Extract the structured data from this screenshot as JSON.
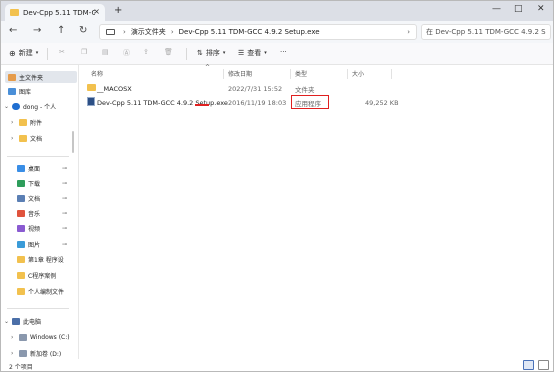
{
  "window": {
    "tab_title": "Dev-Cpp 5.11 TDM-GCC 4.9.2 S",
    "new_tab": "+",
    "minimize": "—",
    "maximize": "□",
    "close": "✕",
    "tab_close": "×"
  },
  "nav": {
    "back": "←",
    "forward": "→",
    "up": "↑",
    "refresh": "↻"
  },
  "address": {
    "crumbs": [
      "演示文件夹",
      "Dev-Cpp 5.11 TDM-GCC 4.9.2 Setup.exe"
    ],
    "search_placeholder": "在 Dev-Cpp 5.11 TDM-GCC 4.9.2 S"
  },
  "toolbar": {
    "new_label": "新建",
    "sort_label": "排序",
    "view_label": "查看",
    "more_label": "···"
  },
  "sidebar": {
    "home": "主文件夹",
    "gallery": "图库",
    "onedrive": "dong - 个人",
    "attachments": "附件",
    "documents_od": "文档",
    "desktop": "桌面",
    "downloads": "下载",
    "documents": "文档",
    "music": "音乐",
    "videos": "视频",
    "pictures": "图片",
    "chapter1": "第1章 程序设",
    "c_examples": "C程序案例",
    "personal": "个人编制文件",
    "this_pc": "此电脑",
    "windows_c": "Windows (C:)",
    "new_volume_d": "新加卷 (D:)",
    "pin_glyph": "⊸"
  },
  "columns": {
    "name": "名称",
    "modified": "修改日期",
    "type": "类型",
    "size": "大小",
    "sort_caret": "^"
  },
  "files": [
    {
      "name": "__MACOSX",
      "modified": "2022/7/31 15:52",
      "type": "文件夹",
      "size": ""
    },
    {
      "name": "Dev-Cpp 5.11 TDM-GCC 4.9.2 Setup.exe",
      "modified": "2016/11/19 18:03",
      "type": "应用程序",
      "size": "49,252 KB"
    }
  ],
  "status": {
    "count": "2 个项目"
  },
  "colors": {
    "accent": "#4a72b8",
    "annotation": "#e02020",
    "folder": "#f2c14e"
  }
}
